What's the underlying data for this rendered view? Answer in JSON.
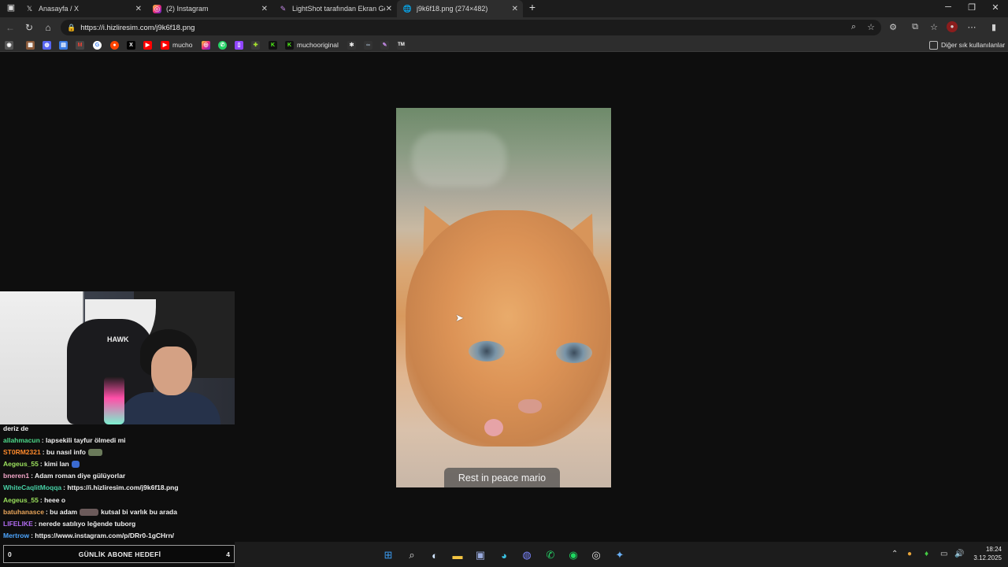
{
  "tabs": [
    {
      "label": "Anasayfa / X",
      "icon": "x-icon"
    },
    {
      "label": "(2) Instagram",
      "icon": "instagram-icon"
    },
    {
      "label": "LightShot tarafından Ekran Görün",
      "icon": "lightshot-icon"
    },
    {
      "label": "j9k6f18.png (274×482)",
      "icon": "globe-icon"
    }
  ],
  "address": {
    "url": "https://i.hizliresim.com/j9k6f18.png"
  },
  "bookmarks": [
    {
      "label": "",
      "icon": "gamepad-icon"
    },
    {
      "label": "",
      "icon": "photo-icon"
    },
    {
      "label": "",
      "icon": "discord-icon"
    },
    {
      "label": "",
      "icon": "docs-icon"
    },
    {
      "label": "",
      "icon": "gmail-icon"
    },
    {
      "label": "",
      "icon": "google-icon"
    },
    {
      "label": "",
      "icon": "reddit-icon"
    },
    {
      "label": "",
      "icon": "x-icon"
    },
    {
      "label": "",
      "icon": "youtube-icon"
    },
    {
      "label": "mucho",
      "icon": "youtube-icon"
    },
    {
      "label": "",
      "icon": "instagram-icon"
    },
    {
      "label": "",
      "icon": "whatsapp-icon"
    },
    {
      "label": "",
      "icon": "twitch-icon"
    },
    {
      "label": "",
      "icon": "puzzle-icon"
    },
    {
      "label": "",
      "icon": "kick-icon"
    },
    {
      "label": "muchooriginal",
      "icon": "kick-icon"
    },
    {
      "label": "",
      "icon": "openai-icon"
    },
    {
      "label": "",
      "icon": "link-icon"
    },
    {
      "label": "",
      "icon": "feather-icon"
    },
    {
      "label": "TM",
      "icon": "tm-icon"
    }
  ],
  "other_bookmarks": "Diğer sık kullanılanlar",
  "image": {
    "caption": "Rest in peace mario"
  },
  "chat": {
    "header": "deriz de",
    "messages": [
      {
        "user": "allahmacun",
        "text": ": lapsekili tayfur ölmedi mi",
        "color": "#4ddb8a"
      },
      {
        "user": "ST0RM2321",
        "text": ": bu nasıl info",
        "color": "#ff8a2b"
      },
      {
        "user": "Aegeus_55",
        "text": ": kimi lan",
        "color": "#9be15d"
      },
      {
        "user": "bneren1",
        "text": ": Adam roman diye gülüyorlar",
        "color": "#f2a6c8"
      },
      {
        "user": "WhiteCaqlitMoqqa",
        "text": ": https://i.hizliresim.com/j9k6f18.png",
        "color": "#47d1a6"
      },
      {
        "user": "Aegeus_55",
        "text": ": heee o",
        "color": "#9be15d"
      },
      {
        "user": "batuhanasce",
        "text": ": bu adam",
        "text2": "kutsal bi varlık bu arada",
        "color": "#e8a55a"
      },
      {
        "user": "LIFELIKE",
        "text": ": nerede satılıyo leğende tuborg",
        "color": "#b06bf0"
      },
      {
        "user": "Mertrow",
        "text": ": https://www.instagram.com/p/DRr0-1gCHrn/",
        "color": "#4da6ff"
      }
    ]
  },
  "goal": {
    "left": "0",
    "label": "GÜNLİK ABONE HEDEFİ",
    "right": "4"
  },
  "webcam": {
    "chair_logo": "HAWK"
  },
  "clock": {
    "time": "18:24",
    "date": "3.12.2025"
  }
}
